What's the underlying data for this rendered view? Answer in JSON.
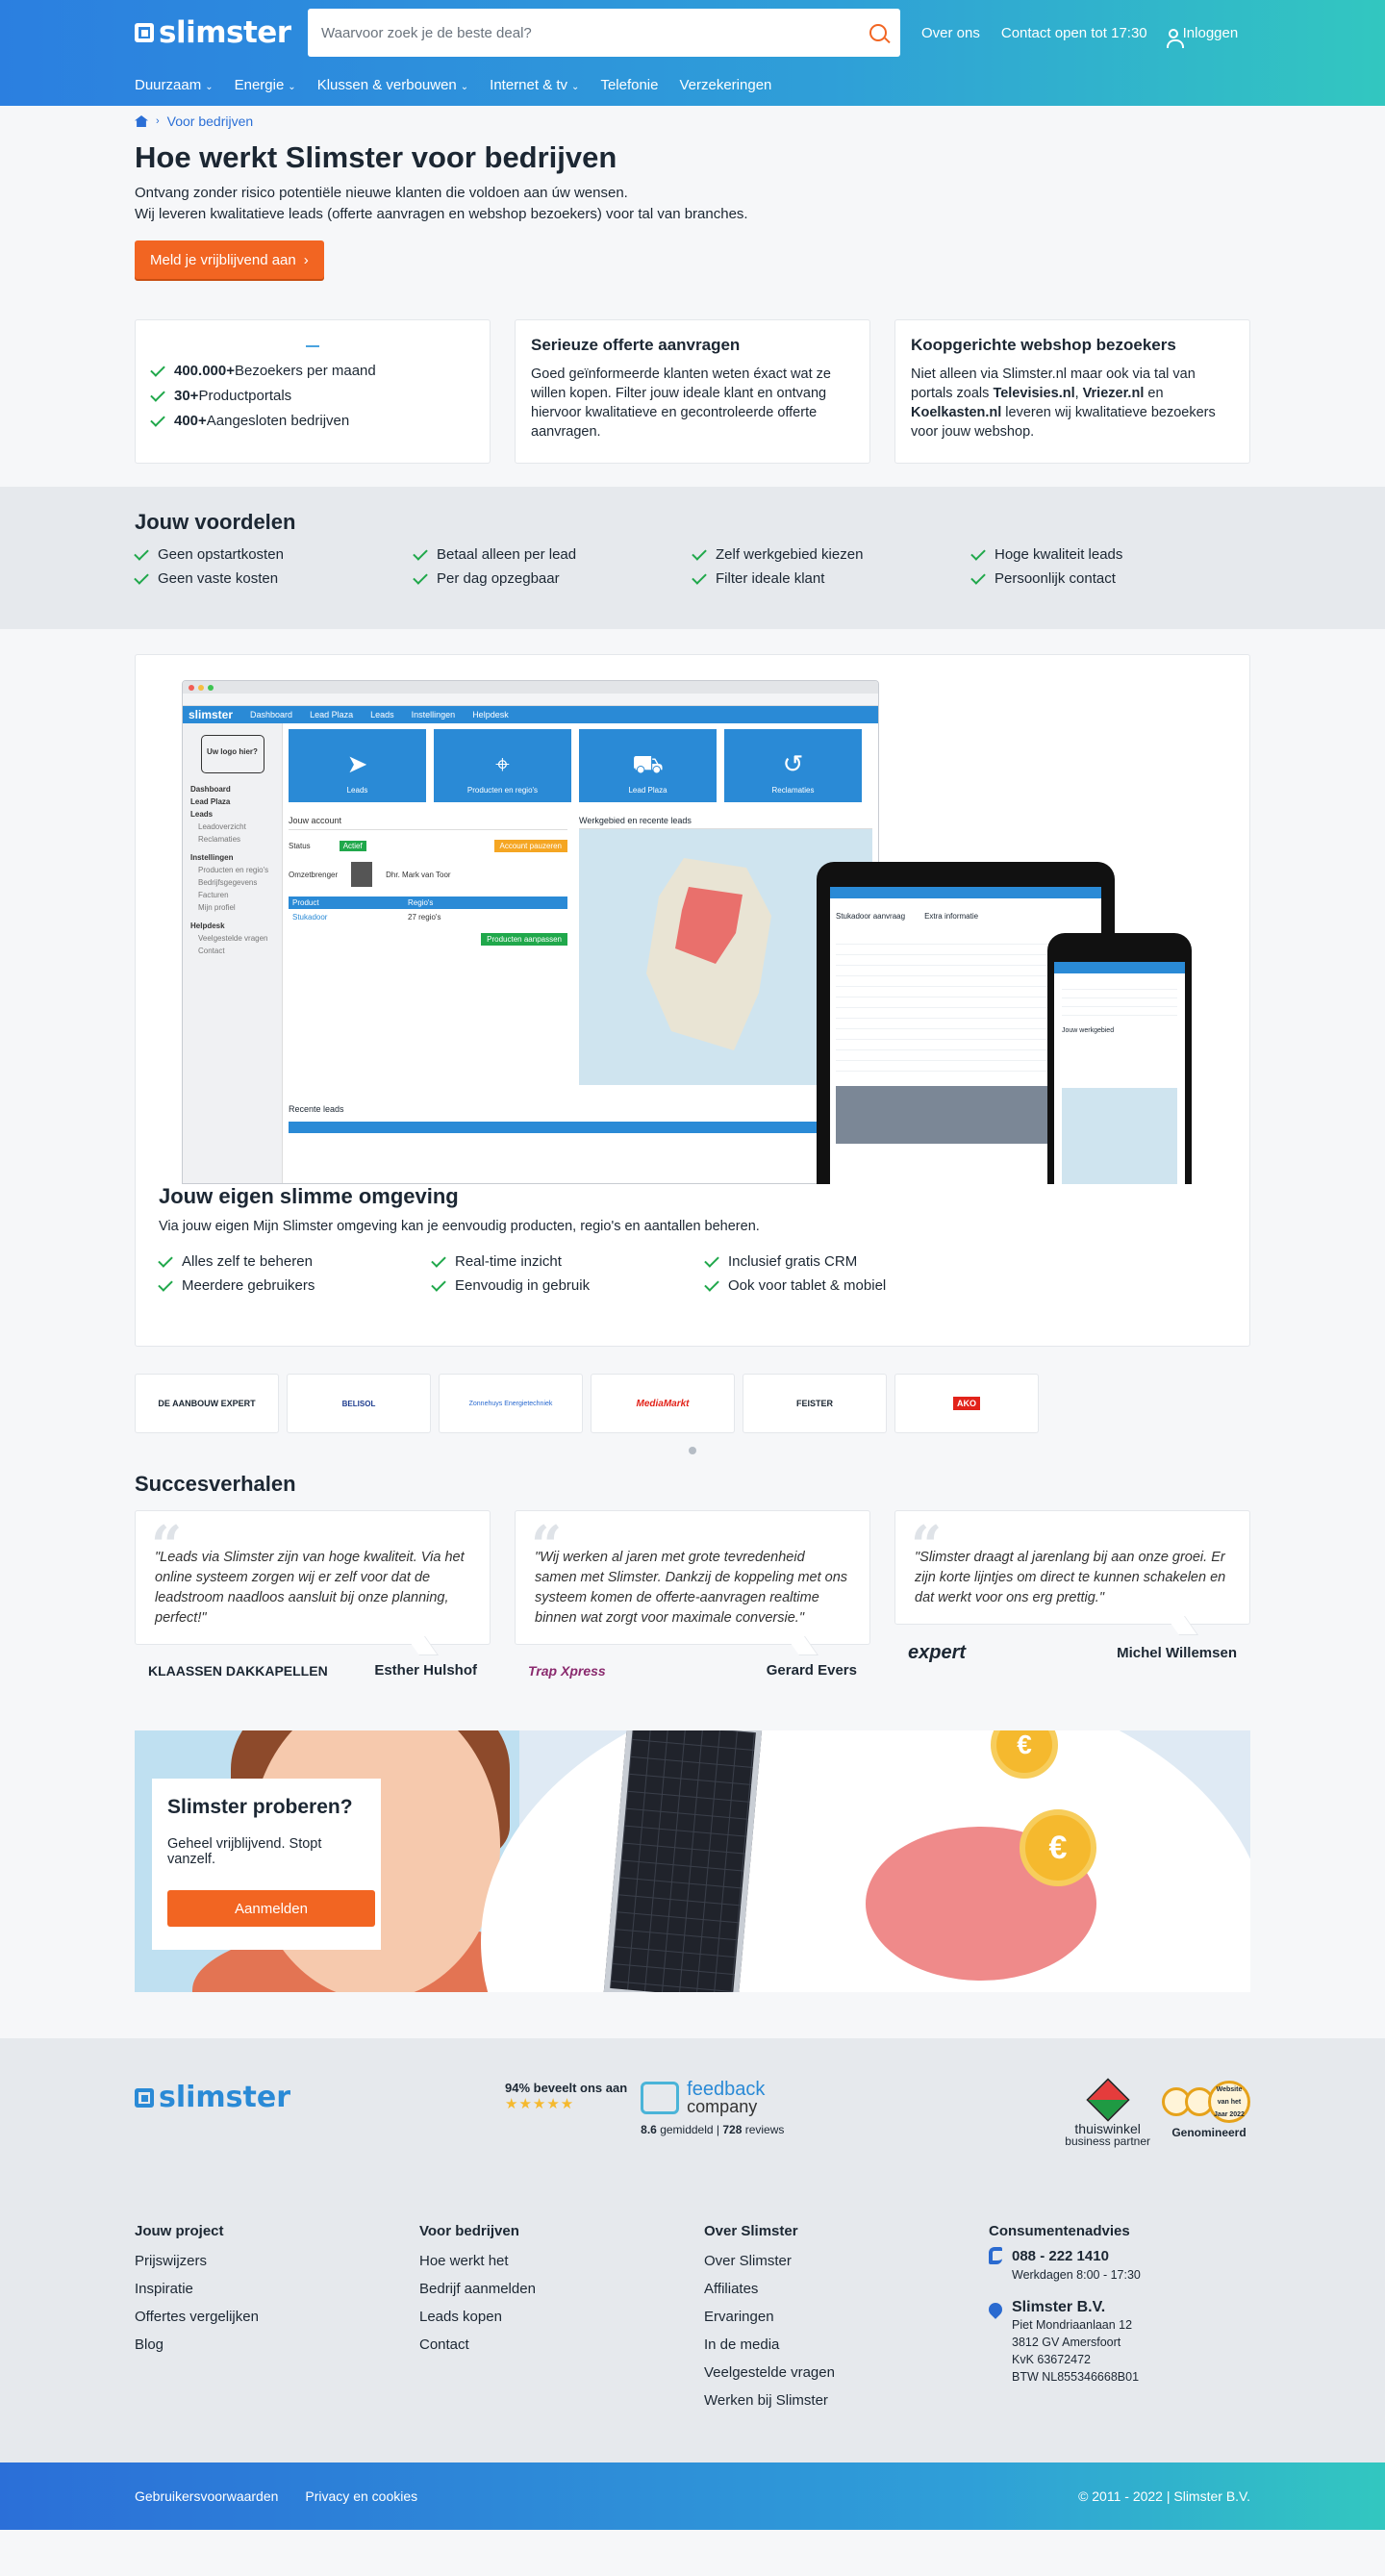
{
  "header": {
    "search_placeholder": "Waarvoor zoek je de beste deal?",
    "logo_text": "slimster",
    "links": [
      "Over ons",
      "Contact open tot 17:30",
      "Inloggen"
    ],
    "nav": [
      {
        "label": "Duurzaam",
        "dropdown": true
      },
      {
        "label": "Energie",
        "dropdown": true
      },
      {
        "label": "Klussen & verbouwen",
        "dropdown": true
      },
      {
        "label": "Internet & tv",
        "dropdown": true
      },
      {
        "label": "Telefonie",
        "dropdown": false
      },
      {
        "label": "Verzekeringen",
        "dropdown": false
      }
    ]
  },
  "hero": {
    "breadcrumb": "Voor bedrijven",
    "title": "Hoe werkt Slimster voor bedrijven",
    "line1": "Ontvang zonder risico potentiële nieuwe klanten die voldoen aan úw wensen.",
    "line2": "Wij leveren kwalitatieve leads (offerte aanvragen en webshop bezoekers) voor tal van branches.",
    "cta": "Meld je vrijblijvend aan"
  },
  "stats": [
    {
      "bold": "400.000+",
      "text": " Bezoekers per maand"
    },
    {
      "bold": "30+",
      "text": " Productportals"
    },
    {
      "bold": "400+",
      "text": " Aangesloten bedrijven"
    }
  ],
  "card2": {
    "title": "Serieuze offerte aanvragen",
    "text": "Goed geïnformeerde klanten weten éxact wat ze willen kopen. Filter jouw ideale klant en ontvang hiervoor kwalitatieve en gecontroleerde offerte aanvragen."
  },
  "card3": {
    "title": "Koopgerichte webshop bezoekers",
    "t1": "Niet alleen via Slimster.nl maar ook via tal van portals zoals ",
    "b1": "Televisies.nl",
    "t2": ", ",
    "b2": "Vriezer.nl",
    "t3": " en ",
    "b3": "Koelkasten.nl",
    "t4": " leveren wij kwalitatieve bezoekers voor jouw webshop."
  },
  "advantages": {
    "title": "Jouw voordelen",
    "items": [
      "Geen opstartkosten",
      "Betaal alleen per lead",
      "Zelf werkgebied kiezen",
      "Hoge kwaliteit leads",
      "Geen vaste kosten",
      "Per dag opzegbaar",
      "Filter ideale klant",
      "Persoonlijk contact"
    ]
  },
  "screenshot": {
    "nav": [
      "slimster",
      "Dashboard",
      "Lead Plaza",
      "Leads",
      "Instellingen",
      "Helpdesk"
    ],
    "logo_box": "Uw logo hier?",
    "side": [
      "Dashboard",
      "Lead Plaza",
      "Leads",
      "Leadoverzicht",
      "Reclamaties",
      "Instellingen",
      "Producten en regio's",
      "Bedrijfsgegevens",
      "Facturen",
      "Mijn profiel",
      "Helpdesk",
      "Veelgestelde vragen",
      "Contact"
    ],
    "tiles": [
      "Leads",
      "Producten en regio's",
      "Lead Plaza",
      "Reclamaties"
    ],
    "account_title": "Jouw account",
    "status_label": "Status",
    "status_value": "Actief",
    "pause_button": "Account pauzeren",
    "manager_label": "Omzetbrenger",
    "manager_name": "Dhr. Mark van Toor",
    "product_col": "Product",
    "region_col": "Regio's",
    "product_value": "Stukadoor",
    "region_value": "27 regio's",
    "adjust_button": "Producten aanpassen",
    "map_title": "Werkgebied en recente leads",
    "recent_title": "Recente leads",
    "tablet_title": "Stukadoor aanvraag",
    "tablet_extra": "Extra informatie",
    "phone_title": "Jouw werkgebied"
  },
  "platform": {
    "title": "Jouw eigen slimme omgeving",
    "text": "Via jouw eigen Mijn Slimster omgeving kan je eenvoudig producten, regio's en aantallen beheren.",
    "items": [
      "Alles zelf te beheren",
      "Real-time inzicht",
      "Inclusief gratis CRM",
      "Meerdere gebruikers",
      "Eenvoudig in gebruik",
      "Ook voor tablet & mobiel"
    ]
  },
  "partner_logos": [
    "DE AANBOUW EXPERT",
    "BELISOL",
    "Zonnehuys Energietechniek",
    "MediaMarkt",
    "FEISTER",
    "AKO"
  ],
  "success": {
    "title": "Succesverhalen",
    "quotes": [
      {
        "text": "\"Leads via Slimster zijn van hoge kwaliteit. Via het online systeem zorgen wij er zelf voor dat de leadstroom naadloos aansluit bij onze planning, perfect!\"",
        "name": "Esther Hulshof",
        "logo": "KLAASSEN DAKKAPELLEN"
      },
      {
        "text": "\"Wij werken al jaren met grote tevredenheid samen met Slimster. Dankzij de koppeling met ons systeem komen de offerte-aanvragen realtime binnen wat zorgt voor maximale conversie.\"",
        "name": "Gerard Evers",
        "logo": "Trap Xpress"
      },
      {
        "text": "\"Slimster draagt al jarenlang bij aan onze groei. Er zijn korte lijntjes om direct te kunnen schakelen en dat werkt voor ons erg prettig.\"",
        "name": "Michel Willemsen",
        "logo": "expert"
      }
    ]
  },
  "cta": {
    "title": "Slimster proberen?",
    "text": "Geheel vrijblijvend. Stopt vanzelf.",
    "button": "Aanmelden",
    "coin": "€"
  },
  "footer": {
    "logo": "slimster",
    "fb_score": "94% beveelt ons aan",
    "stars": "★★★★★",
    "fb_brand": "feedback",
    "fb_brand2": "company",
    "fb_avg": "8.6",
    "fb_avg_label": " gemiddeld | ",
    "fb_reviews": "728",
    "fb_reviews_label": " reviews",
    "tw1": "thuiswinkel",
    "tw2": "business partner",
    "nominated": "Genomineerd",
    "seal_text": "Website van het Jaar 2022",
    "cols": [
      {
        "title": "Jouw project",
        "links": [
          "Prijswijzers",
          "Inspiratie",
          "Offertes vergelijken",
          "Blog"
        ]
      },
      {
        "title": "Voor bedrijven",
        "links": [
          "Hoe werkt het",
          "Bedrijf aanmelden",
          "Leads kopen",
          "Contact"
        ]
      },
      {
        "title": "Over Slimster",
        "links": [
          "Over Slimster",
          "Affiliates",
          "Ervaringen",
          "In de media",
          "Veelgestelde vragen",
          "Werken bij Slimster"
        ]
      }
    ],
    "consumer_title": "Consumentenadvies",
    "phone": "088 - 222 1410",
    "hours": "Werkdagen 8:00 - 17:30",
    "company": "Slimster B.V.",
    "address1": "Piet Mondriaanlaan 12",
    "address2": "3812 GV Amersfoort",
    "kvk": "KvK 63672472",
    "btw": "BTW NL855346668B01",
    "bottom_links": [
      "Gebruikersvoorwaarden",
      "Privacy en cookies"
    ],
    "copyright": "© 2011 - 2022 | Slimster B.V."
  },
  "colors": {
    "primary": "#2b7fe0",
    "accent": "#f26522",
    "check": "#20a84b",
    "teal": "#32c7c0"
  }
}
